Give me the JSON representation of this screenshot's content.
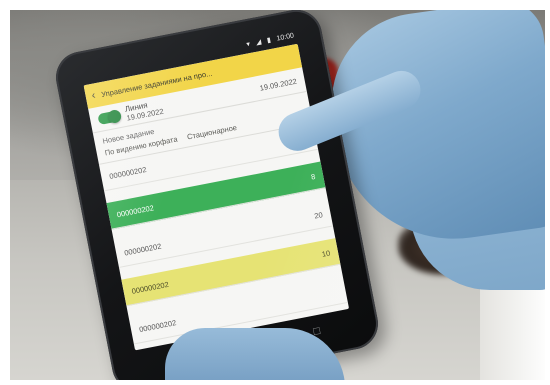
{
  "screen": {
    "header_title": "Управление заданиями на про...",
    "status_time": "10:00",
    "line": {
      "name": "Линия",
      "date_left": "19.09.2022",
      "date_right": "19.09.2022"
    },
    "task": {
      "title": "Новое задание",
      "field_a": "По видению корфата",
      "field_b": "Стационарное"
    },
    "items": [
      {
        "code": "000000202",
        "value": "23",
        "style": "plain"
      },
      {
        "code": "000000202",
        "value": "8",
        "style": "green"
      },
      {
        "code": "000000202",
        "value": "20",
        "style": "plain"
      },
      {
        "code": "000000202",
        "value": "10",
        "style": "yellow"
      },
      {
        "code": "000000202",
        "value": "",
        "style": "plain"
      }
    ]
  }
}
